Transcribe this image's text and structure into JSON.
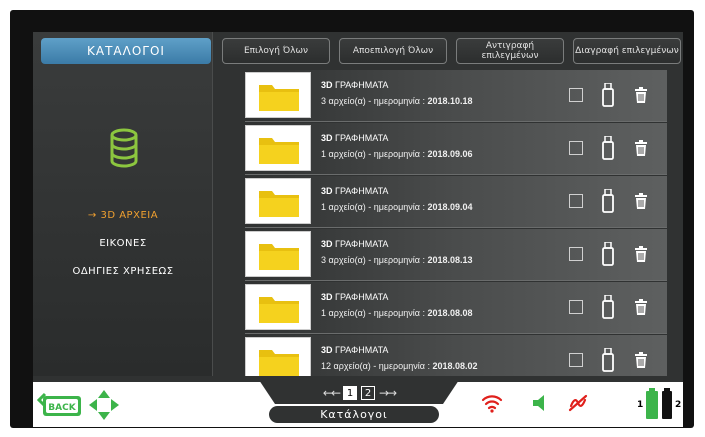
{
  "sidebar": {
    "header": "ΚΑΤΑΛΟΓΟΙ",
    "items": [
      {
        "label": "→ 3D ΑΡΧΕΙΑ",
        "active": true
      },
      {
        "label": "ΕΙΚΟΝΕΣ",
        "active": false
      },
      {
        "label": "ΟΔΗΓΙΕΣ ΧΡΗΣΕΩΣ",
        "active": false
      }
    ]
  },
  "toolbar": {
    "select_all": "Επιλογή Όλων",
    "deselect_all": "Αποεπιλογή Όλων",
    "copy_selected": "Αντιγραφή επιλεγμένων",
    "delete_selected": "Διαγραφή επιλεγμένων"
  },
  "files": [
    {
      "prefix": "3D",
      "name": " ΓΡΑΦΗΜΑΤΑ",
      "count": "3",
      "count_text": " αρχείο(α) - ημερομηνία : ",
      "date": "2018.10.18"
    },
    {
      "prefix": "3D",
      "name": " ΓΡΑΦΗΜΑΤΑ",
      "count": "1",
      "count_text": " αρχείο(α) - ημερομηνία : ",
      "date": "2018.09.06"
    },
    {
      "prefix": "3D",
      "name": " ΓΡΑΦΗΜΑΤΑ",
      "count": "1",
      "count_text": " αρχείο(α) - ημερομηνία : ",
      "date": "2018.09.04"
    },
    {
      "prefix": "3D",
      "name": " ΓΡΑΦΗΜΑΤΑ",
      "count": "3",
      "count_text": " αρχείο(α) - ημερομηνία : ",
      "date": "2018.08.13"
    },
    {
      "prefix": "3D",
      "name": " ΓΡΑΦΗΜΑΤΑ",
      "count": "1",
      "count_text": " αρχείο(α) - ημερομηνία : ",
      "date": "2018.08.08"
    },
    {
      "prefix": "3D",
      "name": " ΓΡΑΦΗΜΑΤΑ",
      "count": "12",
      "count_text": " αρχείο(α) - ημερομηνία : ",
      "date": "2018.08.02"
    }
  ],
  "pager": {
    "prev": "←←",
    "next": "→→",
    "pages": [
      "1",
      "2"
    ],
    "current": "1"
  },
  "bottom": {
    "back_label": "BACK",
    "screen_title": "Κατάλογοι",
    "battery1_label": "1",
    "battery2_label": "2"
  },
  "colors": {
    "accent_blue": "#3b7ba7",
    "active_orange": "#f0a030",
    "db_green": "#8cc63f",
    "folder_yellow": "#f5d21e",
    "wifi_red": "#e0201c",
    "speaker_green": "#3cb44a"
  },
  "icons": {
    "sidebar": "database-icon",
    "row": [
      "folder-icon",
      "checkbox",
      "usb-icon",
      "trash-icon"
    ],
    "bottom": [
      "back-icon",
      "move-arrows-icon",
      "wifi-icon",
      "speaker-icon",
      "signal-icon",
      "battery-icon"
    ]
  }
}
